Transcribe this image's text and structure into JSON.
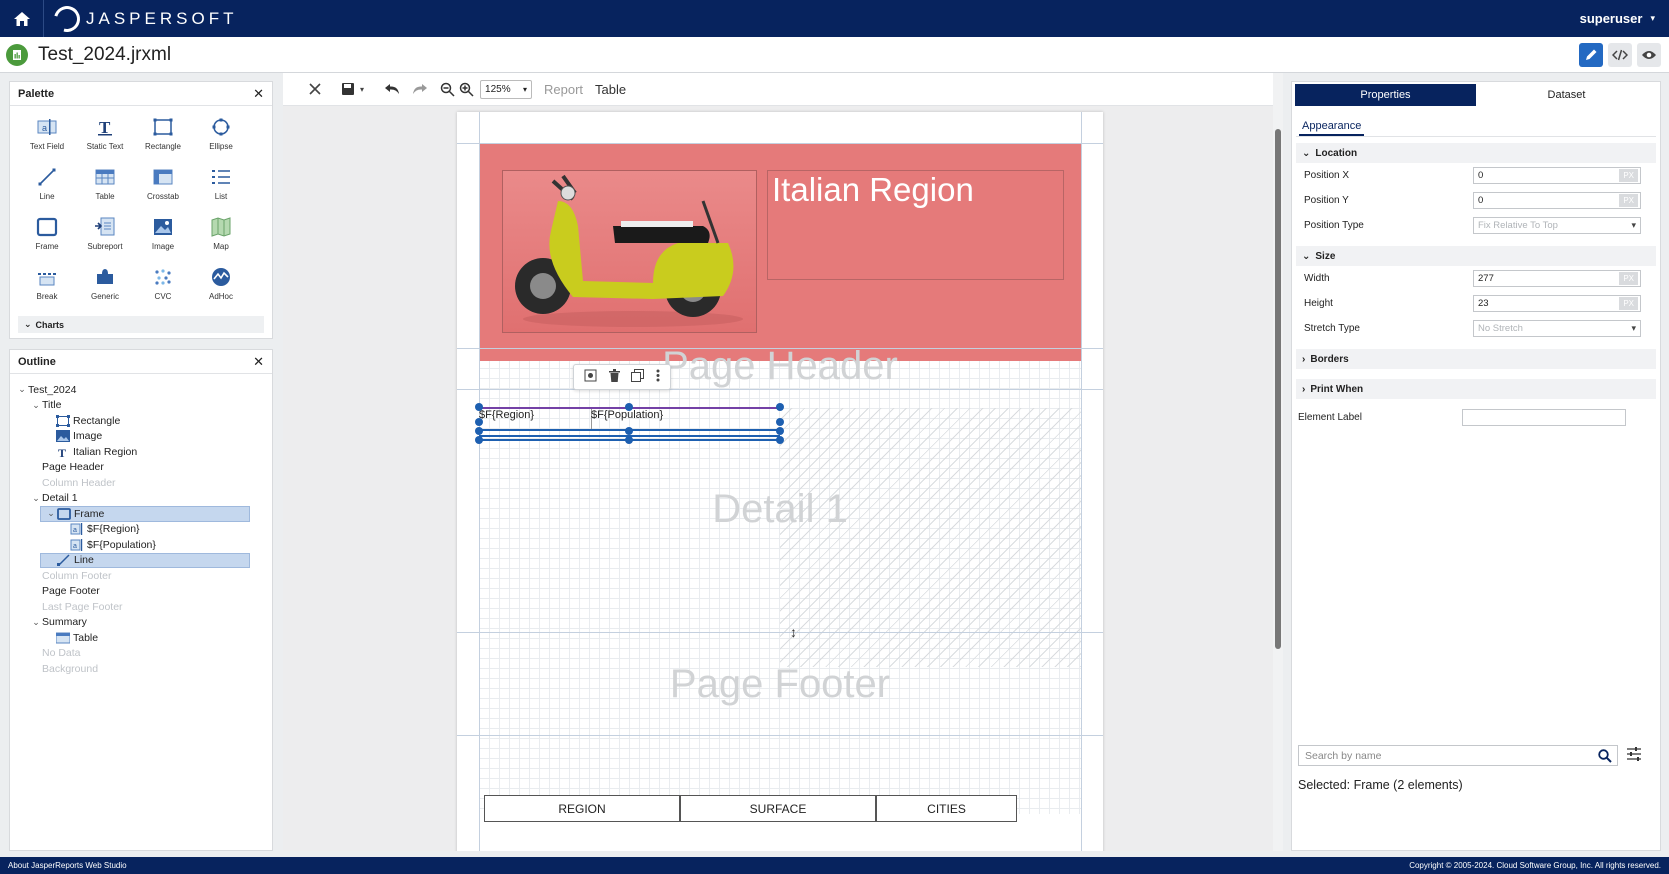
{
  "topbar": {
    "logo_text": "JASPERSOFT",
    "user": "superuser"
  },
  "file": {
    "title": "Test_2024.jrxml"
  },
  "palette": {
    "title": "Palette",
    "items": [
      {
        "label": "Text Field",
        "icon": "text-field-icon"
      },
      {
        "label": "Static Text",
        "icon": "static-text-icon"
      },
      {
        "label": "Rectangle",
        "icon": "rectangle-icon"
      },
      {
        "label": "Ellipse",
        "icon": "ellipse-icon"
      },
      {
        "label": "Line",
        "icon": "line-icon"
      },
      {
        "label": "Table",
        "icon": "table-icon"
      },
      {
        "label": "Crosstab",
        "icon": "crosstab-icon"
      },
      {
        "label": "List",
        "icon": "list-icon"
      },
      {
        "label": "Frame",
        "icon": "frame-icon"
      },
      {
        "label": "Subreport",
        "icon": "subreport-icon"
      },
      {
        "label": "Image",
        "icon": "image-icon"
      },
      {
        "label": "Map",
        "icon": "map-icon"
      },
      {
        "label": "Break",
        "icon": "break-icon"
      },
      {
        "label": "Generic",
        "icon": "generic-icon"
      },
      {
        "label": "CVC",
        "icon": "cvc-icon"
      },
      {
        "label": "AdHoc",
        "icon": "adhoc-icon"
      }
    ],
    "charts_label": "Charts"
  },
  "outline": {
    "title": "Outline",
    "items": [
      {
        "label": "Test_2024",
        "level": 0,
        "caret": "v",
        "icon": "",
        "disabled": false,
        "selected": false
      },
      {
        "label": "Title",
        "level": 1,
        "caret": "v",
        "icon": "",
        "disabled": false,
        "selected": false
      },
      {
        "label": "Rectangle",
        "level": 2,
        "caret": "",
        "icon": "rectangle",
        "disabled": false,
        "selected": false
      },
      {
        "label": "Image",
        "level": 2,
        "caret": "",
        "icon": "image",
        "disabled": false,
        "selected": false
      },
      {
        "label": "Italian Region",
        "level": 2,
        "caret": "",
        "icon": "text",
        "disabled": false,
        "selected": false
      },
      {
        "label": "Page Header",
        "level": 1,
        "caret": "",
        "icon": "",
        "disabled": false,
        "selected": false
      },
      {
        "label": "Column Header",
        "level": 1,
        "caret": "",
        "icon": "",
        "disabled": true,
        "selected": false
      },
      {
        "label": "Detail 1",
        "level": 1,
        "caret": "v",
        "icon": "",
        "disabled": false,
        "selected": false
      },
      {
        "label": "Frame",
        "level": 2,
        "caret": "v",
        "icon": "frame",
        "disabled": false,
        "selected": true
      },
      {
        "label": "$F{Region}",
        "level": 3,
        "caret": "",
        "icon": "field",
        "disabled": false,
        "selected": false
      },
      {
        "label": "$F{Population}",
        "level": 3,
        "caret": "",
        "icon": "field",
        "disabled": false,
        "selected": false
      },
      {
        "label": "Line",
        "level": 2,
        "caret": "",
        "icon": "line",
        "disabled": false,
        "selected": true
      },
      {
        "label": "Column Footer",
        "level": 1,
        "caret": "",
        "icon": "",
        "disabled": true,
        "selected": false
      },
      {
        "label": "Page Footer",
        "level": 1,
        "caret": "",
        "icon": "",
        "disabled": false,
        "selected": false
      },
      {
        "label": "Last Page Footer",
        "level": 1,
        "caret": "",
        "icon": "",
        "disabled": true,
        "selected": false
      },
      {
        "label": "Summary",
        "level": 1,
        "caret": "v",
        "icon": "",
        "disabled": false,
        "selected": false
      },
      {
        "label": "Table",
        "level": 2,
        "caret": "",
        "icon": "table",
        "disabled": false,
        "selected": false
      },
      {
        "label": "No Data",
        "level": 1,
        "caret": "",
        "icon": "",
        "disabled": true,
        "selected": false
      },
      {
        "label": "Background",
        "level": 1,
        "caret": "",
        "icon": "",
        "disabled": true,
        "selected": false
      }
    ]
  },
  "toolbar": {
    "zoom": "125%",
    "crumbs": [
      "Report",
      "Table"
    ]
  },
  "canvas": {
    "title_text": "Italian Region",
    "page_header_label": "Page Header",
    "detail_label": "Detail 1",
    "page_footer_label": "Page Footer",
    "field_region": "$F{Region}",
    "field_population": "$F{Population}",
    "table_headers": [
      "REGION",
      "SURFACE",
      "CITIES"
    ]
  },
  "properties": {
    "tabs": [
      "Properties",
      "Dataset"
    ],
    "subtab": "Appearance",
    "sections": {
      "location": "Location",
      "size": "Size",
      "borders": "Borders",
      "print_when": "Print When"
    },
    "location": [
      {
        "label": "Position X",
        "value": "0",
        "unit": "PX"
      },
      {
        "label": "Position Y",
        "value": "0",
        "unit": "PX"
      }
    ],
    "position_type": {
      "label": "Position Type",
      "value": "Fix Relative To Top"
    },
    "size": [
      {
        "label": "Width",
        "value": "277",
        "unit": "PX"
      },
      {
        "label": "Height",
        "value": "23",
        "unit": "PX"
      }
    ],
    "stretch_type": {
      "label": "Stretch Type",
      "value": "No Stretch"
    },
    "element_label": {
      "label": "Element Label",
      "value": ""
    },
    "search_placeholder": "Search by name",
    "selected_info": "Selected: Frame (2 elements)"
  },
  "footer": {
    "left": "About JasperReports Web Studio",
    "right": "Copyright © 2005-2024. Cloud Software Group, Inc. All rights reserved."
  },
  "colors": {
    "topbar": "#07235e",
    "accent": "#2369c2",
    "title_band": "#e57a7a",
    "selection": "#1d5fb0"
  }
}
